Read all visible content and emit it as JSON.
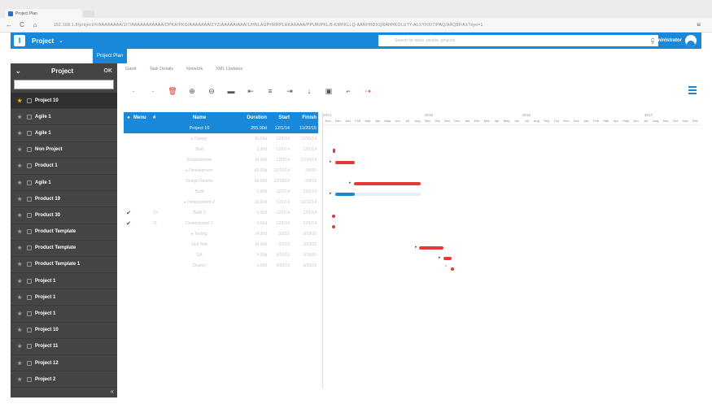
{
  "browser": {
    "tab_title": "Project Plan",
    "url": "152.168.1.8/project/#/AAAAAAAA/1/7/AAAAAAAAAAA/DPKA/PKG/AAAAAAA/ZYZ/AAAAA/AAA/1/HNLAGPHRRPLAKAAAAA/PPUR/PKL/8-KMHKLLQ-AARHHDXQRAHHKOLUTY-ALXYHX/7/PAQ/AAQBFiKk?eye=1",
    "back_icon": "←",
    "reload_icon": "C",
    "home_icon": "⌂",
    "menu_icon": "≡"
  },
  "app": {
    "logo": "I",
    "title": "Project",
    "search_placeholder": "Search for tasks, people, projects",
    "user": "Administrator"
  },
  "tabs": {
    "active": "Project Plan"
  },
  "sidebar": {
    "title": "Project",
    "ok_label": "OK",
    "items": [
      {
        "label": "Project 10",
        "active": true
      },
      {
        "label": "Agile 1"
      },
      {
        "label": "Agile 1"
      },
      {
        "label": "Non Project"
      },
      {
        "label": "Product 1"
      },
      {
        "label": "Agile 1"
      },
      {
        "label": "Product 19"
      },
      {
        "label": "Product 30"
      },
      {
        "label": "Product Template"
      },
      {
        "label": "Product Template"
      },
      {
        "label": "Product Template 1"
      },
      {
        "label": "Project 1"
      },
      {
        "label": "Project 1"
      },
      {
        "label": "Project 1"
      },
      {
        "label": "Project 10"
      },
      {
        "label": "Project 11"
      },
      {
        "label": "Project 12"
      },
      {
        "label": "Project 2"
      }
    ],
    "collapse_icon": "«"
  },
  "subtabs": [
    "Gantt",
    "Task Details",
    "Network",
    "XML Updates"
  ],
  "grid": {
    "headers": {
      "menu": "Menu",
      "num": "#",
      "name": "Name",
      "duration": "Duration",
      "start": "Start",
      "finish": "Finish"
    },
    "selected_row": {
      "name": "Project 10",
      "duration": "255.00d",
      "start": "12/1/14",
      "finish": "11/20/15"
    },
    "rows": [
      {
        "check": "",
        "num": "",
        "name": "▸ Design",
        "duration": "11.00d",
        "start": "12/1/14",
        "finish": "12/15/14"
      },
      {
        "check": "",
        "num": "",
        "name": "Start",
        "duration": "1.00d",
        "start": "12/1/14",
        "finish": "12/1/14"
      },
      {
        "check": "",
        "num": "",
        "name": "Requirements",
        "duration": "10.00d",
        "start": "12/2/14",
        "finish": "12/15/14"
      },
      {
        "check": "",
        "num": "",
        "name": "▸ Development",
        "duration": "60.00d",
        "start": "12/16/14",
        "finish": "3/9/15"
      },
      {
        "check": "",
        "num": "",
        "name": "Design Review",
        "duration": "60.00d",
        "start": "12/16/14",
        "finish": "3/9/15"
      },
      {
        "check": "",
        "num": "",
        "name": "Build",
        "duration": "1.00d",
        "start": "12/1/14",
        "finish": "12/1/14"
      },
      {
        "check": "",
        "num": "",
        "name": "▸ Development 2",
        "duration": "10.00d",
        "start": "12/1/14",
        "finish": "12/12/14"
      },
      {
        "check": "✔",
        "num": "10",
        "name": "Build 2",
        "duration": "1.00d",
        "start": "12/1/14",
        "finish": "12/1/14"
      },
      {
        "check": "✔",
        "num": "11",
        "name": "Development 2",
        "duration": "1.00d",
        "start": "12/1/14",
        "finish": "12/1/14"
      },
      {
        "check": "",
        "num": "",
        "name": "▸ Testing",
        "duration": "14.00d",
        "start": "3/2/15",
        "finish": "3/19/15"
      },
      {
        "check": "",
        "num": "",
        "name": "Unit Test",
        "duration": "10.00d",
        "start": "3/2/15",
        "finish": "3/13/15"
      },
      {
        "check": "",
        "num": "",
        "name": "QA",
        "duration": "4.00d",
        "start": "3/16/15",
        "finish": "3/19/15"
      },
      {
        "check": "",
        "num": "",
        "name": "Deploy",
        "duration": "1.00d",
        "start": "3/20/15",
        "finish": "3/20/15"
      }
    ]
  },
  "gantt": {
    "years": [
      "2014",
      "2015",
      "2016",
      "2017"
    ],
    "months": [
      "Nov",
      "Dec",
      "Jan",
      "Feb",
      "Mar",
      "Apr",
      "May",
      "Jun",
      "Jul",
      "Aug",
      "Sep",
      "Oct",
      "Nov",
      "Dec",
      "Jan",
      "Feb",
      "Mar",
      "Apr",
      "May",
      "Jun",
      "Jul",
      "Aug",
      "Sep",
      "Oct",
      "Nov",
      "Dec",
      "Jan",
      "Feb",
      "Mar",
      "Apr",
      "May",
      "Jun",
      "Jul",
      "Aug",
      "Sep",
      "Oct",
      "Nov",
      "Dec"
    ]
  },
  "toolbar": [
    "add",
    "remove",
    "delete",
    "zoom-in",
    "zoom-out",
    "outdent",
    "indent",
    "link",
    "unlink",
    "task-up",
    "resource",
    "baseline",
    "critical"
  ]
}
